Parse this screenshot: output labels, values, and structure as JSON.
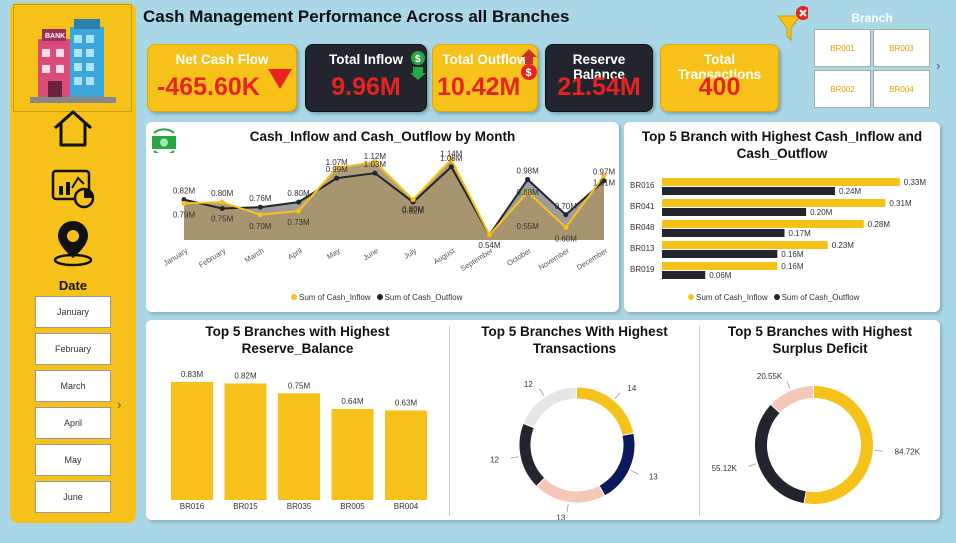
{
  "header": {
    "title": "Cash Management Performance Across all Branches"
  },
  "sidebar": {
    "date_title": "Date",
    "months": [
      "January",
      "February",
      "March",
      "April",
      "May",
      "June"
    ]
  },
  "kpis": {
    "net_cash_flow": {
      "label": "Net Cash Flow",
      "value": "-465.60K"
    },
    "total_inflow": {
      "label": "Total Inflow",
      "value": "9.96M"
    },
    "total_outflow": {
      "label": "Total Outflow",
      "value": "10.42M"
    },
    "reserve_balance": {
      "label": "Reserve Balance",
      "value": "21.54M"
    },
    "total_transactions": {
      "label": "Total Transactions",
      "value": "400"
    }
  },
  "branch_slicer": {
    "title": "Branch",
    "options": [
      "BR001",
      "BR003",
      "BR002",
      "BR004"
    ]
  },
  "colors": {
    "yellow": "#f6c21a",
    "dark": "#23252e",
    "navy": "#0b1a5c",
    "peach": "#f4c7b6",
    "grey": "#e6e6e6"
  },
  "chart_data": [
    {
      "type": "area",
      "title": "Cash_Inflow and Cash_Outflow by Month",
      "categories": [
        "January",
        "February",
        "March",
        "April",
        "May",
        "June",
        "July",
        "August",
        "September",
        "October",
        "November",
        "December"
      ],
      "series": [
        {
          "name": "Sum of Cash_Inflow",
          "values": [
            0.79,
            0.8,
            0.7,
            0.73,
            1.07,
            1.12,
            0.82,
            1.14,
            0.54,
            0.88,
            0.6,
            1.01
          ],
          "labels": [
            "0.79M",
            "",
            "0.70M",
            "0.73M",
            "1.07M",
            "1.12M",
            "0.82M",
            "1.14M",
            "",
            "",
            "0.60M",
            "1.01M"
          ]
        },
        {
          "name": "Sum of Cash_Outflow",
          "values": [
            0.82,
            0.75,
            0.76,
            0.8,
            0.99,
            1.03,
            0.8,
            1.08,
            0.54,
            0.98,
            0.7,
            0.97
          ],
          "labels": [
            "0.82M",
            "0.75M",
            "0.76M",
            "0.80M",
            "0.99M",
            "1.03M",
            "0.80M",
            "1.08M",
            "0.54M",
            "0.98M",
            "0.70M",
            "0.97M"
          ]
        }
      ],
      "extra_labels": {
        "february_top": "0.80M",
        "october_mid": "0.88M",
        "october_low": "0.55M"
      },
      "legend": [
        "Sum of Cash_Inflow",
        "Sum of Cash_Outflow"
      ]
    },
    {
      "type": "bar",
      "title": "Top 5 Branch with Highest Cash_Inflow and Cash_Outflow",
      "categories": [
        "BR016",
        "BR041",
        "BR048",
        "BR013",
        "BR019"
      ],
      "series": [
        {
          "name": "Sum of Cash_Inflow",
          "values": [
            0.33,
            0.31,
            0.28,
            0.23,
            0.16
          ],
          "labels": [
            "0.33M",
            "0.31M",
            "0.28M",
            "0.23M",
            "0.16M"
          ]
        },
        {
          "name": "Sum of Cash_Outflow",
          "values": [
            0.24,
            0.2,
            0.17,
            0.16,
            0.06
          ],
          "labels": [
            "0.24M",
            "0.20M",
            "0.17M",
            "0.16M",
            "0.06M"
          ]
        }
      ],
      "legend": [
        "Sum of Cash_Inflow",
        "Sum of Cash_Outflow"
      ]
    },
    {
      "type": "bar",
      "title": "Top 5 Branches with Highest Reserve_Balance",
      "categories": [
        "BR016",
        "BR015",
        "BR035",
        "BR005",
        "BR004"
      ],
      "values": [
        0.83,
        0.82,
        0.75,
        0.64,
        0.63
      ],
      "labels": [
        "0.83M",
        "0.82M",
        "0.75M",
        "0.64M",
        "0.63M"
      ]
    },
    {
      "type": "pie",
      "title": "Top 5 Branches With Highest Transactions",
      "values": [
        14,
        13,
        13,
        12,
        12
      ],
      "labels": [
        "14",
        "13",
        "13",
        "12",
        "12"
      ]
    },
    {
      "type": "pie",
      "title": "Top 5 Branches with Highest Surplus Deficit",
      "values": [
        84.72,
        55.12,
        20.55
      ],
      "labels": [
        "84.72K",
        "55.12K",
        "20.55K"
      ]
    }
  ]
}
